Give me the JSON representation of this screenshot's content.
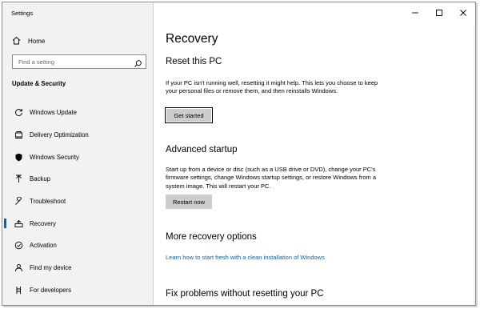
{
  "window": {
    "title": "Settings",
    "minimize_glyph": "—",
    "maximize_glyph": "☐",
    "close_glyph": "✕"
  },
  "sidebar": {
    "home_label": "Home",
    "search_placeholder": "Find a setting",
    "section_title": "Update & Security",
    "items": [
      {
        "label": "Windows Update",
        "icon": "refresh-icon"
      },
      {
        "label": "Delivery Optimization",
        "icon": "delivery-optimization-icon"
      },
      {
        "label": "Windows Security",
        "icon": "shield-icon"
      },
      {
        "label": "Backup",
        "icon": "backup-arrow-icon"
      },
      {
        "label": "Troubleshoot",
        "icon": "wrench-icon"
      },
      {
        "label": "Recovery",
        "icon": "recovery-icon",
        "active": true
      },
      {
        "label": "Activation",
        "icon": "checkmark-circle-icon"
      },
      {
        "label": "Find my device",
        "icon": "person-location-icon"
      },
      {
        "label": "For developers",
        "icon": "developer-tools-icon"
      }
    ]
  },
  "main": {
    "title": "Recovery",
    "reset": {
      "heading": "Reset this PC",
      "description": "If your PC isn't running well, resetting it might help. This lets you choose to keep your personal files or remove them, and then reinstalls Windows.",
      "button": "Get started"
    },
    "advanced": {
      "heading": "Advanced startup",
      "description": "Start up from a device or disc (such as a USB drive or DVD), change your PC's firmware settings, change Windows startup settings, or restore Windows from a system image. This will restart your PC.",
      "button": "Restart now"
    },
    "more": {
      "heading": "More recovery options",
      "link": "Learn how to start fresh with a clean installation of Windows"
    },
    "fix": {
      "heading": "Fix problems without resetting your PC"
    }
  },
  "colors": {
    "accent": "#0067c0",
    "link": "#0066b4",
    "sidebar_bg": "#f2f2f2",
    "button_bg": "#cccccc"
  }
}
